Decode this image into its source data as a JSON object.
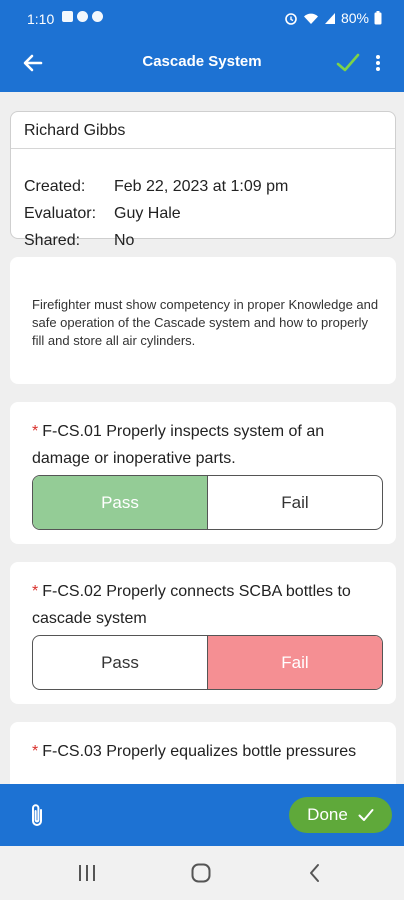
{
  "status": {
    "time": "1:10",
    "battery": "80%"
  },
  "appbar": {
    "title": "Cascade System"
  },
  "record": {
    "name": "Richard Gibbs",
    "rows": [
      {
        "label": "Created:",
        "value": "Feb 22, 2023 at 1:09 pm"
      },
      {
        "label": "Evaluator:",
        "value": "Guy Hale"
      },
      {
        "label": "Shared:",
        "value": "No"
      }
    ]
  },
  "description": "Firefighter must show competency in proper Knowledge and safe operation of the Cascade system and how to properly fill and store all air cylinders.",
  "questions": [
    {
      "required": "*",
      "text": "F-CS.01 Properly inspects system of an damage or inoperative parts.",
      "pass": "Pass",
      "fail": "Fail",
      "selected": "Pass"
    },
    {
      "required": "*",
      "text": "F-CS.02 Properly connects SCBA bottles to cascade system",
      "pass": "Pass",
      "fail": "Fail",
      "selected": "Fail"
    },
    {
      "required": "*",
      "text": "F-CS.03 Properly equalizes bottle pressures"
    }
  ],
  "footer": {
    "done_label": "Done"
  },
  "colors": {
    "primary": "#1d72d3",
    "pass": "#94cc96",
    "fail": "#f58f93",
    "done": "#5fa93a",
    "required": "#d9302c"
  },
  "icons": [
    "back-arrow-icon",
    "checkmark-icon",
    "more-vert-icon",
    "paperclip-icon",
    "check-icon",
    "recent-apps-icon",
    "home-icon",
    "back-nav-icon"
  ]
}
